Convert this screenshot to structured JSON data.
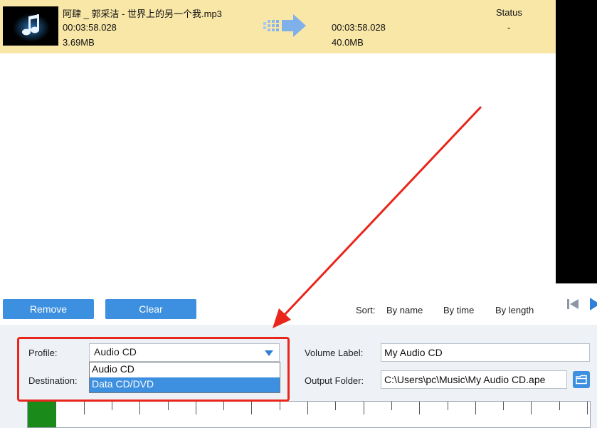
{
  "file": {
    "name": "阿肆 _ 郭采洁 - 世界上的另一个我.mp3",
    "source_duration": "00:03:58.028",
    "source_size": "3.69MB",
    "output_duration": "00:03:58.028",
    "output_size": "40.0MB",
    "status_header": "Status",
    "status_value": "-"
  },
  "actions": {
    "remove_label": "Remove",
    "clear_label": "Clear"
  },
  "sort": {
    "label": "Sort:",
    "options": [
      "By name",
      "By time",
      "By length"
    ]
  },
  "settings": {
    "profile_label": "Profile:",
    "profile_value": "Audio CD",
    "profile_options": [
      "Audio CD",
      "Data CD/DVD"
    ],
    "destination_label": "Destination:",
    "volume_label_label": "Volume Label:",
    "volume_label_value": "My Audio CD",
    "output_folder_label": "Output Folder:",
    "output_folder_value": "C:\\Users\\pc\\Music\\My Audio CD.ape"
  },
  "capacity": {
    "used_fraction": 0.05
  },
  "icons": {
    "thumbnail": "music-note-icon",
    "convert_arrow": "convert-arrow-icon",
    "dropdown_caret": "caret-down-icon",
    "folder": "folder-icon",
    "player_prev": "skip-back-icon",
    "player_play": "play-icon"
  },
  "colors": {
    "selected_row": "#f9e7a8",
    "accent_blue": "#3d8fdf",
    "annotation_red": "#e8261c",
    "capacity_green": "#1a8a1a"
  }
}
